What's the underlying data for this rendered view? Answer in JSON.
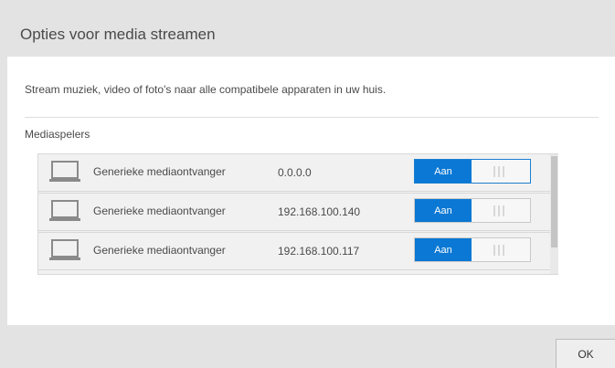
{
  "dialog": {
    "title": "Opties voor media streamen",
    "description": "Stream muziek, video of foto's naar alle compatibele apparaten in uw huis.",
    "section_label": "Mediaspelers",
    "ok_label": "OK"
  },
  "players": [
    {
      "name": "Generieke mediaontvanger",
      "ip": "0.0.0.0",
      "toggle_label": "Aan",
      "enabled": true
    },
    {
      "name": "Generieke mediaontvanger",
      "ip": "192.168.100.140",
      "toggle_label": "Aan",
      "enabled": true
    },
    {
      "name": "Generieke mediaontvanger",
      "ip": "192.168.100.117",
      "toggle_label": "Aan",
      "enabled": true
    }
  ],
  "icons": {
    "device": "laptop-icon",
    "toggle_grip": "grip-lines-icon"
  },
  "colors": {
    "accent": "#0a78d4",
    "panel": "#ffffff",
    "background": "#e3e3e3"
  }
}
